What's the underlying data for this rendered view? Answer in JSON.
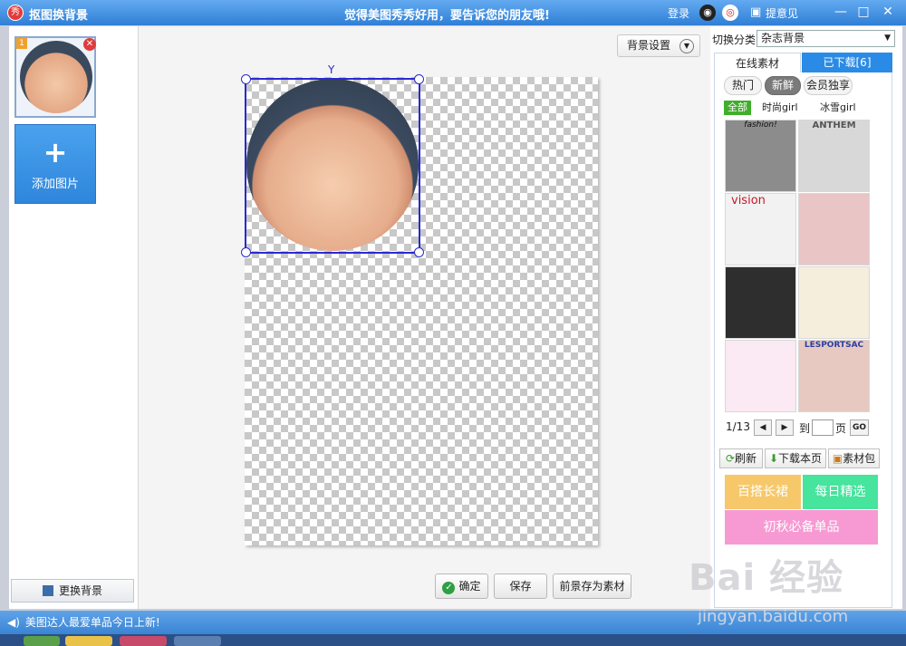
{
  "titlebar": {
    "app_logo": "秀",
    "title": "抠图换背景",
    "slogan": "觉得美图秀秀好用，要告诉您的朋友哦!",
    "login": "登录",
    "feedback": "提意见",
    "icons": [
      "qq-icon",
      "weibo-icon",
      "chat-icon"
    ],
    "window_buttons": [
      "minimize-icon",
      "maximize-icon",
      "close-icon"
    ]
  },
  "left_panel": {
    "thumb_index": "1",
    "add_picture": "添加图片",
    "change_background": "更换背景"
  },
  "canvas": {
    "bg_settings": "背景设置",
    "confirm": "确定",
    "save": "保存",
    "save_foreground": "前景存为素材"
  },
  "right_panel": {
    "category_label": "切换分类",
    "category_value": "杂志背景",
    "tabs": {
      "online": "在线素材",
      "downloaded": "已下载[6]"
    },
    "subtabs": [
      "热门",
      "新鲜",
      "会员独享"
    ],
    "filters": [
      "全部",
      "时尚girl",
      "冰雪girl"
    ],
    "tiles": [
      {
        "caption": "fashion!",
        "color": "#8c8c8c"
      },
      {
        "caption": "ANTHEM",
        "color": "#d8d8d8"
      },
      {
        "caption": "vision",
        "color": "#f2f2f2"
      },
      {
        "caption": "",
        "color": "#e9c5c5"
      },
      {
        "caption": "",
        "color": "#2e2e2e"
      },
      {
        "caption": "",
        "color": "#f6eedd"
      },
      {
        "caption": "",
        "color": "#fbe9f3"
      },
      {
        "caption": "LESPORTSAC",
        "color": "#e7c9c2"
      }
    ],
    "pager": {
      "current": "1/13",
      "goto": "到",
      "page": "页",
      "go": "GO"
    },
    "tools": {
      "refresh": "刷新",
      "download_page": "下载本页",
      "package": "素材包"
    },
    "promos": [
      {
        "label": "百搭长裙",
        "color": "#f6c86a"
      },
      {
        "label": "每日精选",
        "color": "#46e49d"
      },
      {
        "label": "初秋必备单品",
        "color": "#f79ad3"
      }
    ]
  },
  "statusbar": {
    "text": "美图达人最爱单品今日上新!"
  },
  "watermark": {
    "logo": "Bai 经验",
    "url": "jingyan.baidu.com"
  }
}
